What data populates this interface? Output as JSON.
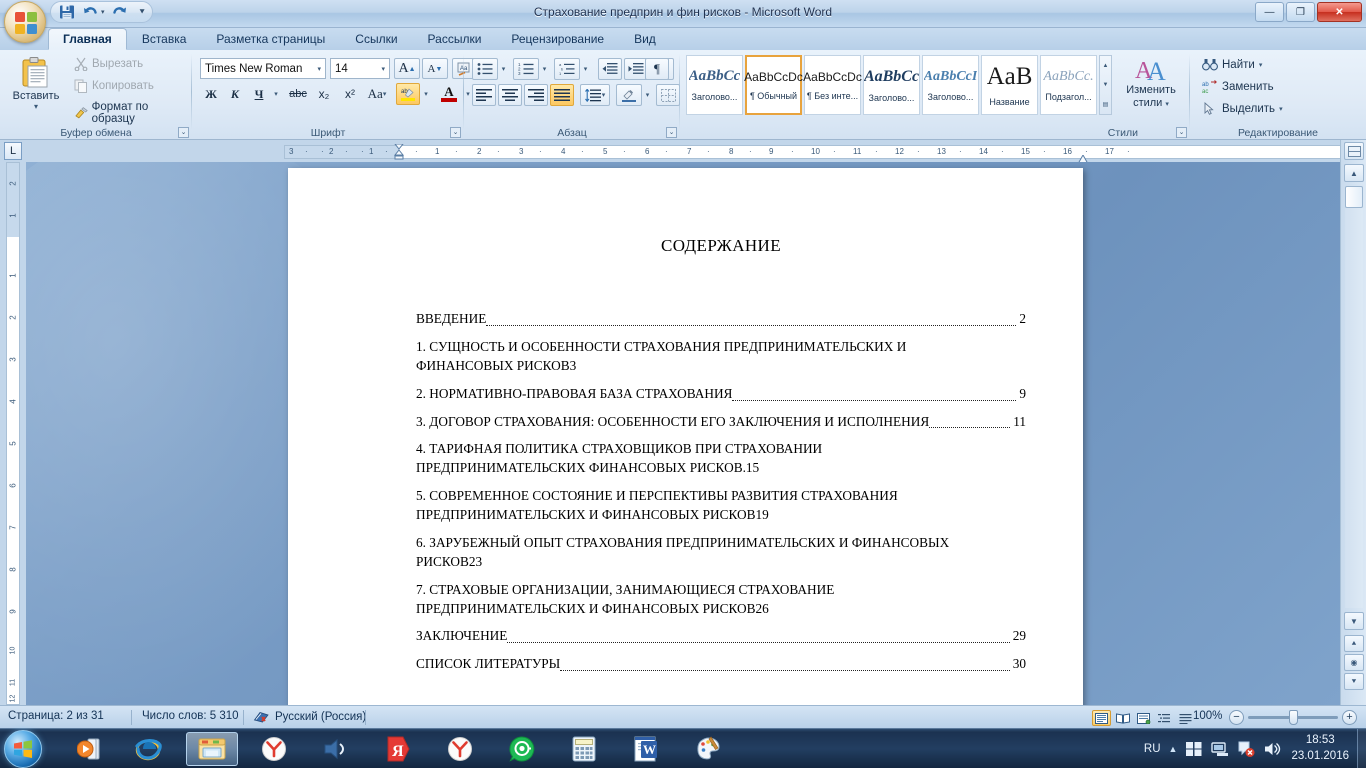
{
  "window": {
    "title": "Страхование предприн и фин рисков - Microsoft Word",
    "minimize_label": "—",
    "restore_label": "❐",
    "close_label": "✕"
  },
  "quick_access": {
    "items": [
      {
        "name": "save-icon",
        "label": "Сохранить"
      },
      {
        "name": "undo-icon",
        "label": "Отменить"
      },
      {
        "name": "redo-icon",
        "label": "Вернуть"
      },
      {
        "name": "customize-qat-icon",
        "label": "Настройка панели быстрого доступа"
      }
    ]
  },
  "ribbon": {
    "tabs": [
      {
        "label": "Главная",
        "active": true
      },
      {
        "label": "Вставка",
        "active": false
      },
      {
        "label": "Разметка страницы",
        "active": false
      },
      {
        "label": "Ссылки",
        "active": false
      },
      {
        "label": "Рассылки",
        "active": false
      },
      {
        "label": "Рецензирование",
        "active": false
      },
      {
        "label": "Вид",
        "active": false
      }
    ],
    "groups": {
      "clipboard": {
        "title": "Буфер обмена",
        "paste": "Вставить",
        "cut": "Вырезать",
        "copy": "Копировать",
        "format_painter": "Формат по образцу"
      },
      "font": {
        "title": "Шрифт",
        "font_name": "Times New Roman",
        "font_size": "14",
        "grow_font": "A",
        "shrink_font": "A",
        "clear_formatting": "Aa",
        "bold": "Ж",
        "italic": "К",
        "underline": "Ч",
        "strikethrough": "abc",
        "subscript": "x₂",
        "superscript": "x²",
        "change_case": "Aa",
        "highlight": "ab",
        "font_color": "A"
      },
      "paragraph": {
        "title": "Абзац",
        "bullets": "bullets-icon",
        "numbering": "numbering-icon",
        "multilevel": "multilevel-list-icon",
        "decrease_indent": "decrease-indent-icon",
        "increase_indent": "increase-indent-icon",
        "sort": "sort-icon",
        "show_marks": "¶",
        "align_left": "align-left-icon",
        "align_center": "align-center-icon",
        "align_right": "align-right-icon",
        "align_justify": "align-justify-icon",
        "line_spacing": "line-spacing-icon",
        "shading": "shading-icon",
        "borders": "borders-icon"
      },
      "styles": {
        "title": "Стили",
        "gallery": [
          {
            "preview": "AaBbCс",
            "name": "Заголово...",
            "selected": false
          },
          {
            "preview": "AaBbCcDc",
            "name": "¶ Обычный",
            "selected": true
          },
          {
            "preview": "AaBbCcDc",
            "name": "¶ Без инте...",
            "selected": false
          },
          {
            "preview": "AaBbCс",
            "name": "Заголово...",
            "selected": false
          },
          {
            "preview": "AaBbCcI",
            "name": "Заголово...",
            "selected": false
          },
          {
            "preview": "AaB",
            "name": "Название",
            "selected": false
          },
          {
            "preview": "AaBbCc.",
            "name": "Подзагол...",
            "selected": false
          }
        ],
        "change_styles": "Изменить стили"
      },
      "editing": {
        "title": "Редактирование",
        "find": "Найти",
        "replace": "Заменить",
        "select": "Выделить"
      }
    }
  },
  "ruler": {
    "h_ticks": [
      "3",
      "2",
      "1",
      "1",
      "2",
      "3",
      "4",
      "5",
      "6",
      "7",
      "8",
      "9",
      "10",
      "11",
      "12",
      "13",
      "14",
      "15",
      "16",
      "17"
    ],
    "v_ticks": [
      "2",
      "1",
      "1",
      "2",
      "3",
      "4",
      "5",
      "6",
      "7",
      "8",
      "9",
      "10",
      "11",
      "12"
    ],
    "tab_stop_selector": "L"
  },
  "document": {
    "heading": "СОДЕРЖАНИЕ",
    "entries": [
      {
        "lines": [
          "ВВЕДЕНИЕ"
        ],
        "page": "2"
      },
      {
        "lines": [
          "1.  СУЩНОСТЬ И ОСОБЕННОСТИ СТРАХОВАНИЯ ПРЕДПРИНИМАТЕЛЬСКИХ И",
          "ФИНАНСОВЫХ РИСКОВ"
        ],
        "page": "3"
      },
      {
        "lines": [
          "2. НОРМАТИВНО-ПРАВОВАЯ БАЗА СТРАХОВАНИЯ"
        ],
        "page": "9"
      },
      {
        "lines": [
          "3. ДОГОВОР СТРАХОВАНИЯ: ОСОБЕННОСТИ ЕГО ЗАКЛЮЧЕНИЯ И ИСПОЛНЕНИЯ"
        ],
        "page": "11"
      },
      {
        "lines": [
          "4. ТАРИФНАЯ ПОЛИТИКА СТРАХОВЩИКОВ ПРИ СТРАХОВАНИИ",
          "ПРЕДПРИНИМАТЕЛЬСКИХ ФИНАНСОВЫХ РИСКОВ."
        ],
        "page": "15"
      },
      {
        "lines": [
          "5. СОВРЕМЕННОЕ СОСТОЯНИЕ И ПЕРСПЕКТИВЫ РАЗВИТИЯ СТРАХОВАНИЯ",
          "ПРЕДПРИНИМАТЕЛЬСКИХ И ФИНАНСОВЫХ РИСКОВ"
        ],
        "page": "19"
      },
      {
        "lines": [
          "6. ЗАРУБЕЖНЫЙ ОПЫТ СТРАХОВАНИЯ ПРЕДПРИНИМАТЕЛЬСКИХ И ФИНАНСОВЫХ",
          "РИСКОВ"
        ],
        "page": "23"
      },
      {
        "lines": [
          "7. СТРАХОВЫЕ ОРГАНИЗАЦИИ, ЗАНИМАЮЩИЕСЯ СТРАХОВАНИЕ",
          "ПРЕДПРИНИМАТЕЛЬСКИХ И ФИНАНСОВЫХ РИСКОВ"
        ],
        "page": "26"
      },
      {
        "lines": [
          "ЗАКЛЮЧЕНИЕ"
        ],
        "page": "29"
      },
      {
        "lines": [
          "СПИСОК ЛИТЕРАТУРЫ"
        ],
        "page": "30"
      }
    ]
  },
  "status_bar": {
    "page": "Страница: 2 из 31",
    "words": "Число слов: 5 310",
    "language": "Русский (Россия)",
    "proofing_icon": "spellcheck-icon",
    "zoom": "100%",
    "zoom_out": "−",
    "zoom_in": "+",
    "views": [
      {
        "name": "print-layout-view",
        "selected": true
      },
      {
        "name": "full-screen-reading-view",
        "selected": false
      },
      {
        "name": "web-layout-view",
        "selected": false
      },
      {
        "name": "outline-view",
        "selected": false
      },
      {
        "name": "draft-view",
        "selected": false
      }
    ]
  },
  "taskbar": {
    "start": "start-orb",
    "items": [
      {
        "name": "media-player-icon",
        "state": "pinned"
      },
      {
        "name": "internet-explorer-icon",
        "state": "pinned"
      },
      {
        "name": "explorer-icon",
        "state": "active"
      },
      {
        "name": "yandex-browser-icon",
        "state": "pinned"
      },
      {
        "name": "volume-app-icon",
        "state": "pinned"
      },
      {
        "name": "yandex-ya-icon",
        "state": "pinned"
      },
      {
        "name": "yandex-browser-2-icon",
        "state": "pinned"
      },
      {
        "name": "icq-mail-agent-icon",
        "state": "pinned"
      },
      {
        "name": "calculator-icon",
        "state": "pinned"
      },
      {
        "name": "word-icon",
        "state": "pinned"
      },
      {
        "name": "paint-icon",
        "state": "pinned"
      }
    ],
    "tray": {
      "language": "RU",
      "show_hidden_icons": "▲",
      "icons": [
        "windows-flag-icon",
        "network-icon",
        "action-center-icon",
        "volume-icon"
      ],
      "time": "18:53",
      "date": "23.01.2016"
    }
  }
}
